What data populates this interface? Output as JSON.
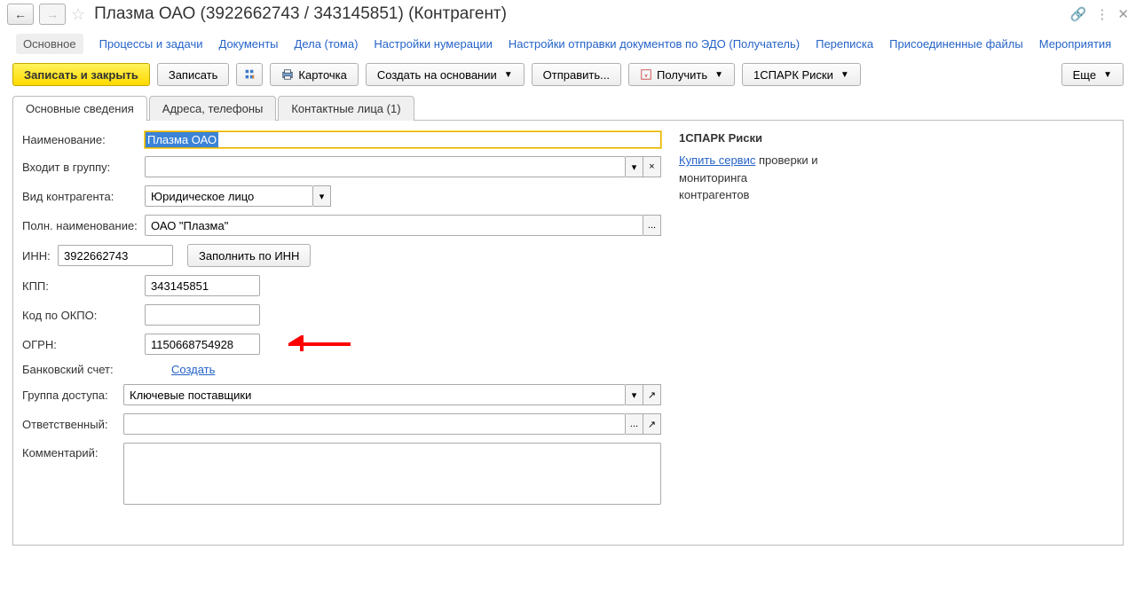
{
  "header": {
    "title": "Плазма ОАО (3922662743 / 343145851) (Контрагент)"
  },
  "topnav": {
    "main": "Основное",
    "processes": "Процессы и задачи",
    "documents": "Документы",
    "cases": "Дела (тома)",
    "numbering": "Настройки нумерации",
    "edo": "Настройки отправки документов по ЭДО (Получатель)",
    "correspondence": "Переписка",
    "attached": "Присоединенные файлы",
    "events": "Мероприятия"
  },
  "toolbar": {
    "save_close": "Записать и закрыть",
    "save": "Записать",
    "card": "Карточка",
    "create_from": "Создать на основании",
    "send": "Отправить...",
    "receive": "Получить",
    "spark": "1СПАРК Риски",
    "more": "Еще"
  },
  "tabs": {
    "general": "Основные сведения",
    "addresses": "Адреса, телефоны",
    "contacts": "Контактные лица (1)"
  },
  "form": {
    "name_label": "Наименование:",
    "name_value": "Плазма ОАО",
    "group_label": "Входит в группу:",
    "group_value": "",
    "type_label": "Вид контрагента:",
    "type_value": "Юридическое лицо",
    "fullname_label": "Полн. наименование:",
    "fullname_value": "ОАО \"Плазма\"",
    "inn_label": "ИНН:",
    "inn_value": "3922662743",
    "fill_inn": "Заполнить по ИНН",
    "kpp_label": "КПП:",
    "kpp_value": "343145851",
    "okpo_label": "Код по ОКПО:",
    "okpo_value": "",
    "ogrn_label": "ОГРН:",
    "ogrn_value": "1150668754928",
    "bank_label": "Банковский счет:",
    "bank_create": "Создать",
    "access_label": "Группа доступа:",
    "access_value": "Ключевые поставщики",
    "responsible_label": "Ответственный:",
    "responsible_value": "",
    "comment_label": "Комментарий:",
    "comment_value": ""
  },
  "sidebar": {
    "title": "1СПАРК Риски",
    "buy": "Купить сервис",
    "text": " проверки и мониторинга контрагентов"
  }
}
